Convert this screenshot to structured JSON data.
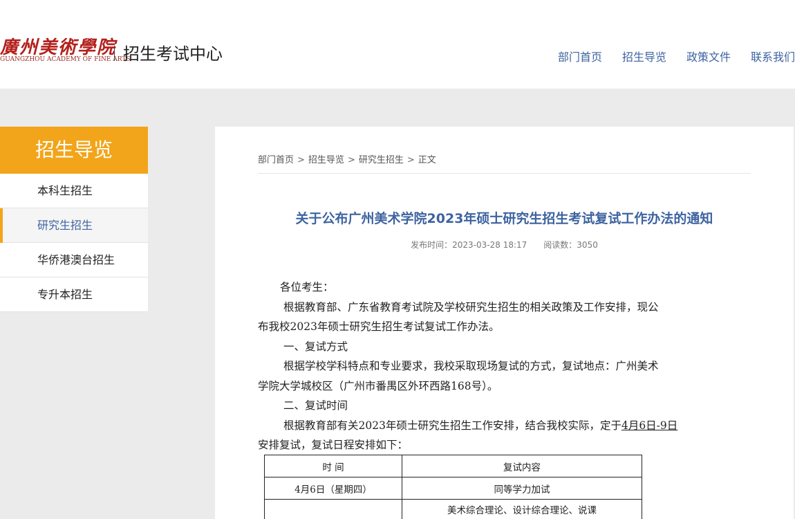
{
  "header": {
    "logo_cn": "廣州美術學院",
    "logo_en": "GUANGZHOU ACADEMY OF FINE ARTS",
    "center_title": "招生考试中心",
    "nav": [
      "部门首页",
      "招生导览",
      "政策文件",
      "联系我们"
    ]
  },
  "sidebar": {
    "title": "招生导览",
    "items": [
      {
        "label": "本科生招生"
      },
      {
        "label": "研究生招生"
      },
      {
        "label": "华侨港澳台招生"
      },
      {
        "label": "专升本招生"
      }
    ]
  },
  "breadcrumb": [
    "部门首页",
    "招生导览",
    "研究生招生",
    "正文"
  ],
  "breadcrumb_separator": ">",
  "article": {
    "title": "关于公布广州美术学院2023年硕士研究生招生考试复试工作办法的通知",
    "publish_time": "发布时间：2023-03-28 18:17",
    "views": "阅读数：3050",
    "greeting": "各位考生：",
    "p1_line1": "根据教育部、广东省教育考试院及学校研究生招生的相关政策及工作安排，现公",
    "p1_line2": "布我校2023年硕士研究生招生考试复试工作办法。",
    "h1": "一、复试方式",
    "p2_line1": "根据学校学科特点和专业要求，我校采取现场复试的方式，复试地点：广州美术",
    "p2_line2": "学院大学城校区（广州市番禺区外环西路168号）。",
    "h2": "二、复试时间",
    "p3_line1_pre": "根据教育部有关2023年硕士研究生招生工作安排，结合我校实际，定于",
    "p3_line1_date": "4月6日-9日",
    "p3_line2": "安排复试，复试日程安排如下：",
    "table": {
      "headers": [
        "时 间",
        "复试内容"
      ],
      "rows": [
        [
          "4月6日（星期四）",
          "同等学力加试"
        ],
        [
          "",
          "美术综合理论、设计综合理论、说课"
        ]
      ]
    }
  },
  "colors": {
    "accent_orange": "#f2a51a",
    "link_blue": "#3d63a0",
    "logo_red": "#b3201c"
  }
}
